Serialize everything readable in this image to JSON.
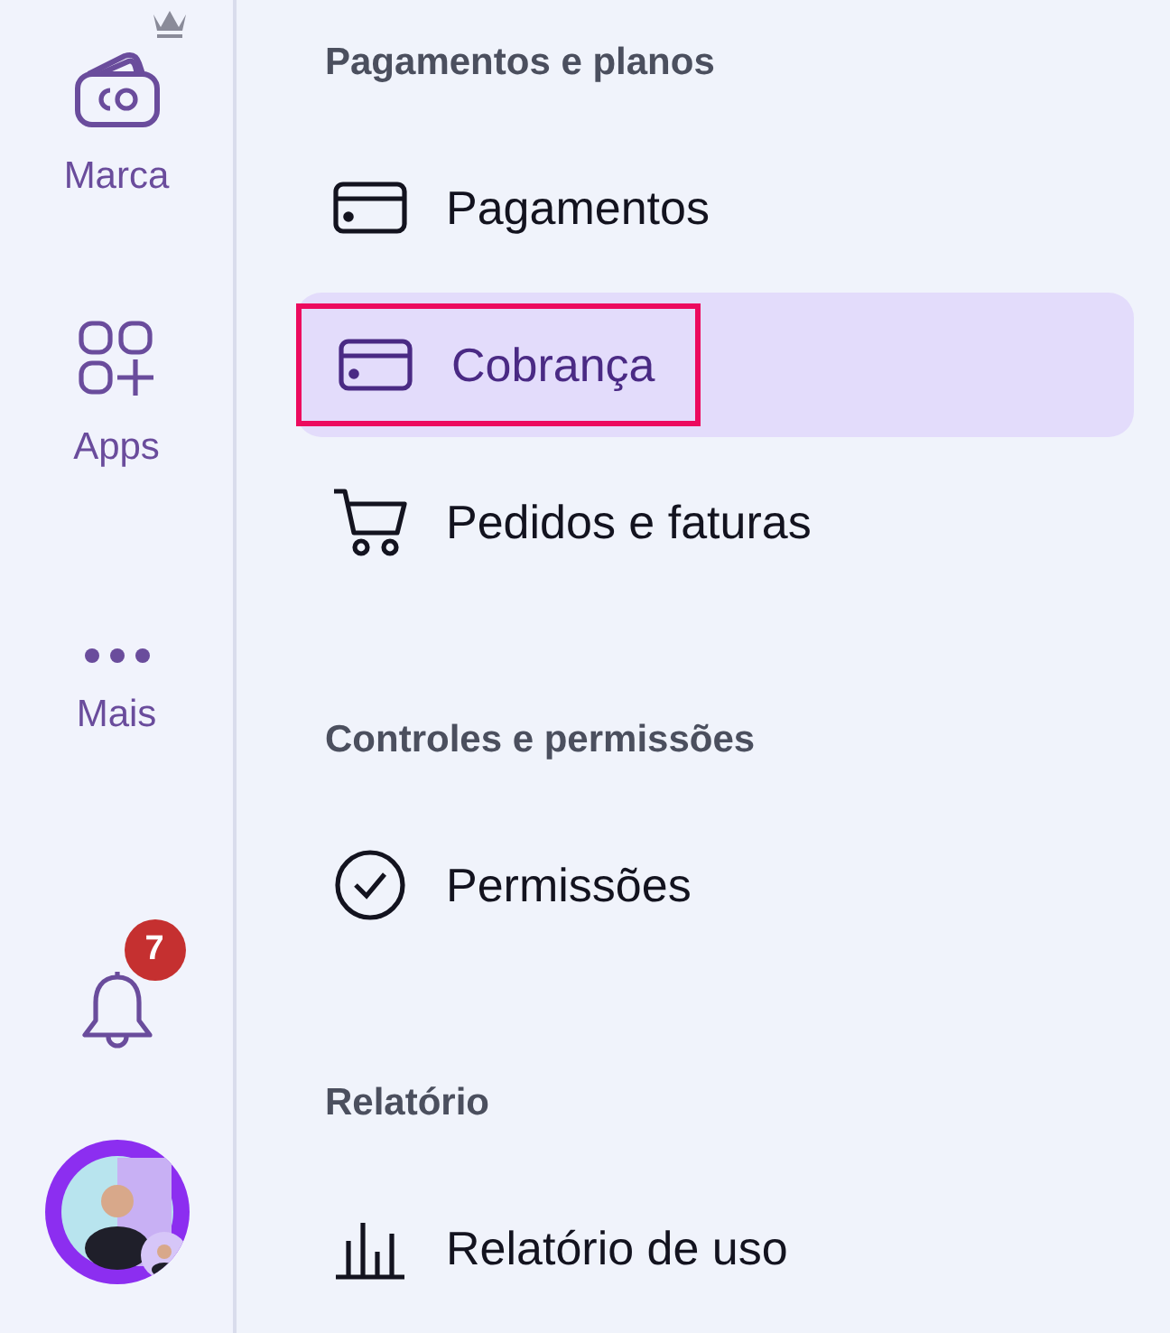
{
  "sidebar": {
    "items": [
      {
        "kind": "brand",
        "label": "Marca",
        "premium": true
      },
      {
        "kind": "apps",
        "label": "Apps",
        "premium": false
      },
      {
        "kind": "more",
        "label": "Mais",
        "premium": false
      }
    ],
    "notifications": {
      "badge": "7"
    }
  },
  "sections": [
    {
      "title": "Pagamentos e planos",
      "items": [
        {
          "kind": "card",
          "label": "Pagamentos",
          "selected": false,
          "annotated": false
        },
        {
          "kind": "card",
          "label": "Cobrança",
          "selected": true,
          "annotated": true
        },
        {
          "kind": "cart",
          "label": "Pedidos e faturas",
          "selected": false,
          "annotated": false
        }
      ]
    },
    {
      "title": "Controles e permissões",
      "items": [
        {
          "kind": "check",
          "label": "Permissões",
          "selected": false,
          "annotated": false
        }
      ]
    },
    {
      "title": "Relatório",
      "items": [
        {
          "kind": "chart",
          "label": "Relatório de uso",
          "selected": false,
          "annotated": false
        }
      ]
    }
  ]
}
